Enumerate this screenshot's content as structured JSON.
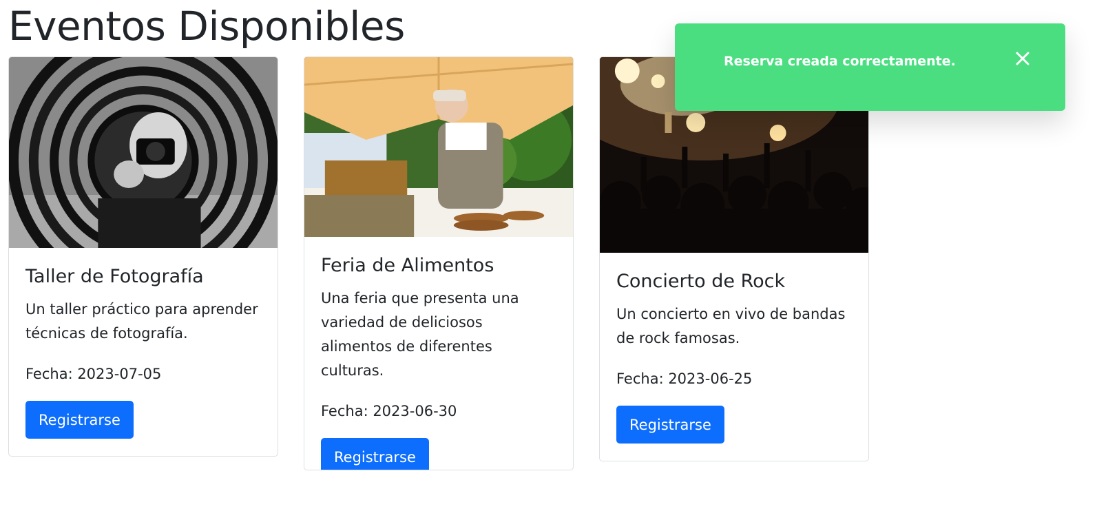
{
  "page": {
    "title": "Eventos Disponibles"
  },
  "toast": {
    "message": "Reserva creada correctamente.",
    "color": "#4ade80",
    "close_icon": "close-icon"
  },
  "events": [
    {
      "title": "Taller de Fotografía",
      "description": "Un taller práctico para aprender técnicas de fotografía.",
      "date": "Fecha: 2023-07-05",
      "button": "Registrarse",
      "image": "photographer-through-rings-image"
    },
    {
      "title": "Feria de Alimentos",
      "description": "Una feria que presenta una variedad de deliciosos alimentos de diferentes culturas.",
      "date": "Fecha: 2023-06-30",
      "button": "Registrarse",
      "image": "food-market-stall-image"
    },
    {
      "title": "Concierto de Rock",
      "description": "Un concierto en vivo de bandas de rock famosas.",
      "date": "Fecha: 2023-06-25",
      "button": "Registrarse",
      "image": "rock-concert-crowd-image"
    }
  ],
  "colors": {
    "primary": "#0d6efd",
    "text": "#212529",
    "success_toast": "#4ade80"
  }
}
